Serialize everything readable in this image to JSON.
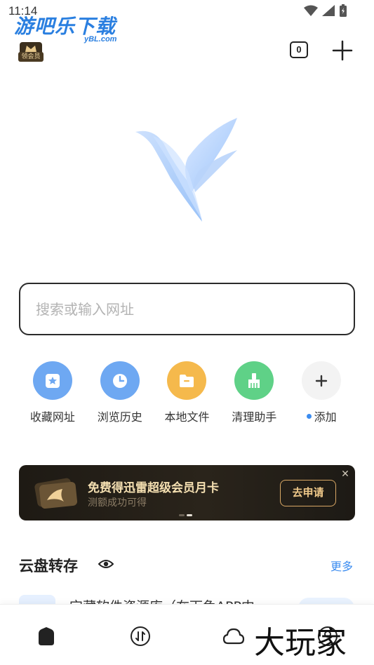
{
  "status_bar": {
    "time": "11:14"
  },
  "watermark": {
    "title": "游吧乐下载",
    "sub": "yBL.com",
    "corner": "大玩家"
  },
  "header": {
    "vip_label": "领会员",
    "tab_count": "0"
  },
  "search": {
    "placeholder": "搜索或输入网址"
  },
  "shortcuts": [
    {
      "label": "收藏网址",
      "icon": "bookmark-icon",
      "color": "#6ea8f2"
    },
    {
      "label": "浏览历史",
      "icon": "clock-icon",
      "color": "#6ea8f2"
    },
    {
      "label": "本地文件",
      "icon": "folder-icon",
      "color": "#f5b94c"
    },
    {
      "label": "清理助手",
      "icon": "broom-icon",
      "color": "#5fd187"
    },
    {
      "label": "添加",
      "icon": "plus-icon",
      "color": "#f3f3f3"
    }
  ],
  "banner": {
    "title": "免费得迅雷超级会员月卡",
    "subtitle": "测额成功可得",
    "button": "去申请"
  },
  "cloud_section": {
    "title": "云盘转存",
    "more": "更多",
    "item_text": "宝藏软件资源库（在下兔APP中"
  },
  "bottom_nav": [
    "home-icon",
    "transfer-icon",
    "cloud-icon",
    "profile-icon"
  ]
}
